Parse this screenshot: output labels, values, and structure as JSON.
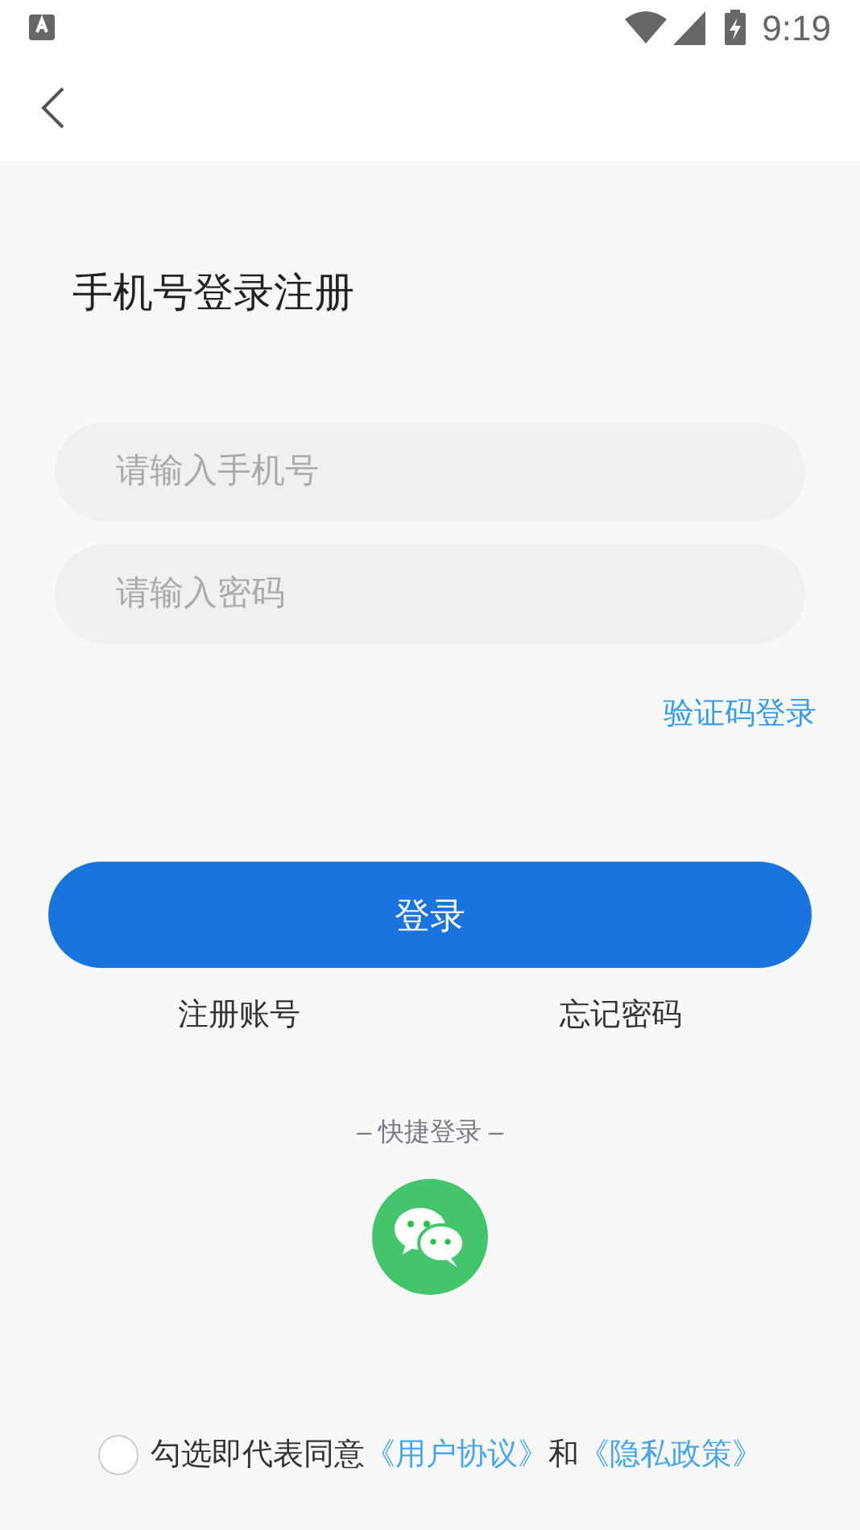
{
  "status_bar": {
    "time": "9:19"
  },
  "title": "手机号登录注册",
  "fields": [
    {
      "placeholder": "请输入手机号"
    },
    {
      "placeholder": "请输入密码"
    }
  ],
  "sms_login_link": "验证码登录",
  "login_button": "登录",
  "register_link": "注册账号",
  "forgot_link": "忘记密码",
  "quick_login": {
    "label": "– 快捷登录 –"
  },
  "agreement": {
    "checked": false,
    "prefix": "勾选即代表同意",
    "user_agreement": "《用户协议》",
    "middle": "和",
    "privacy_policy": "《隐私政策》"
  }
}
